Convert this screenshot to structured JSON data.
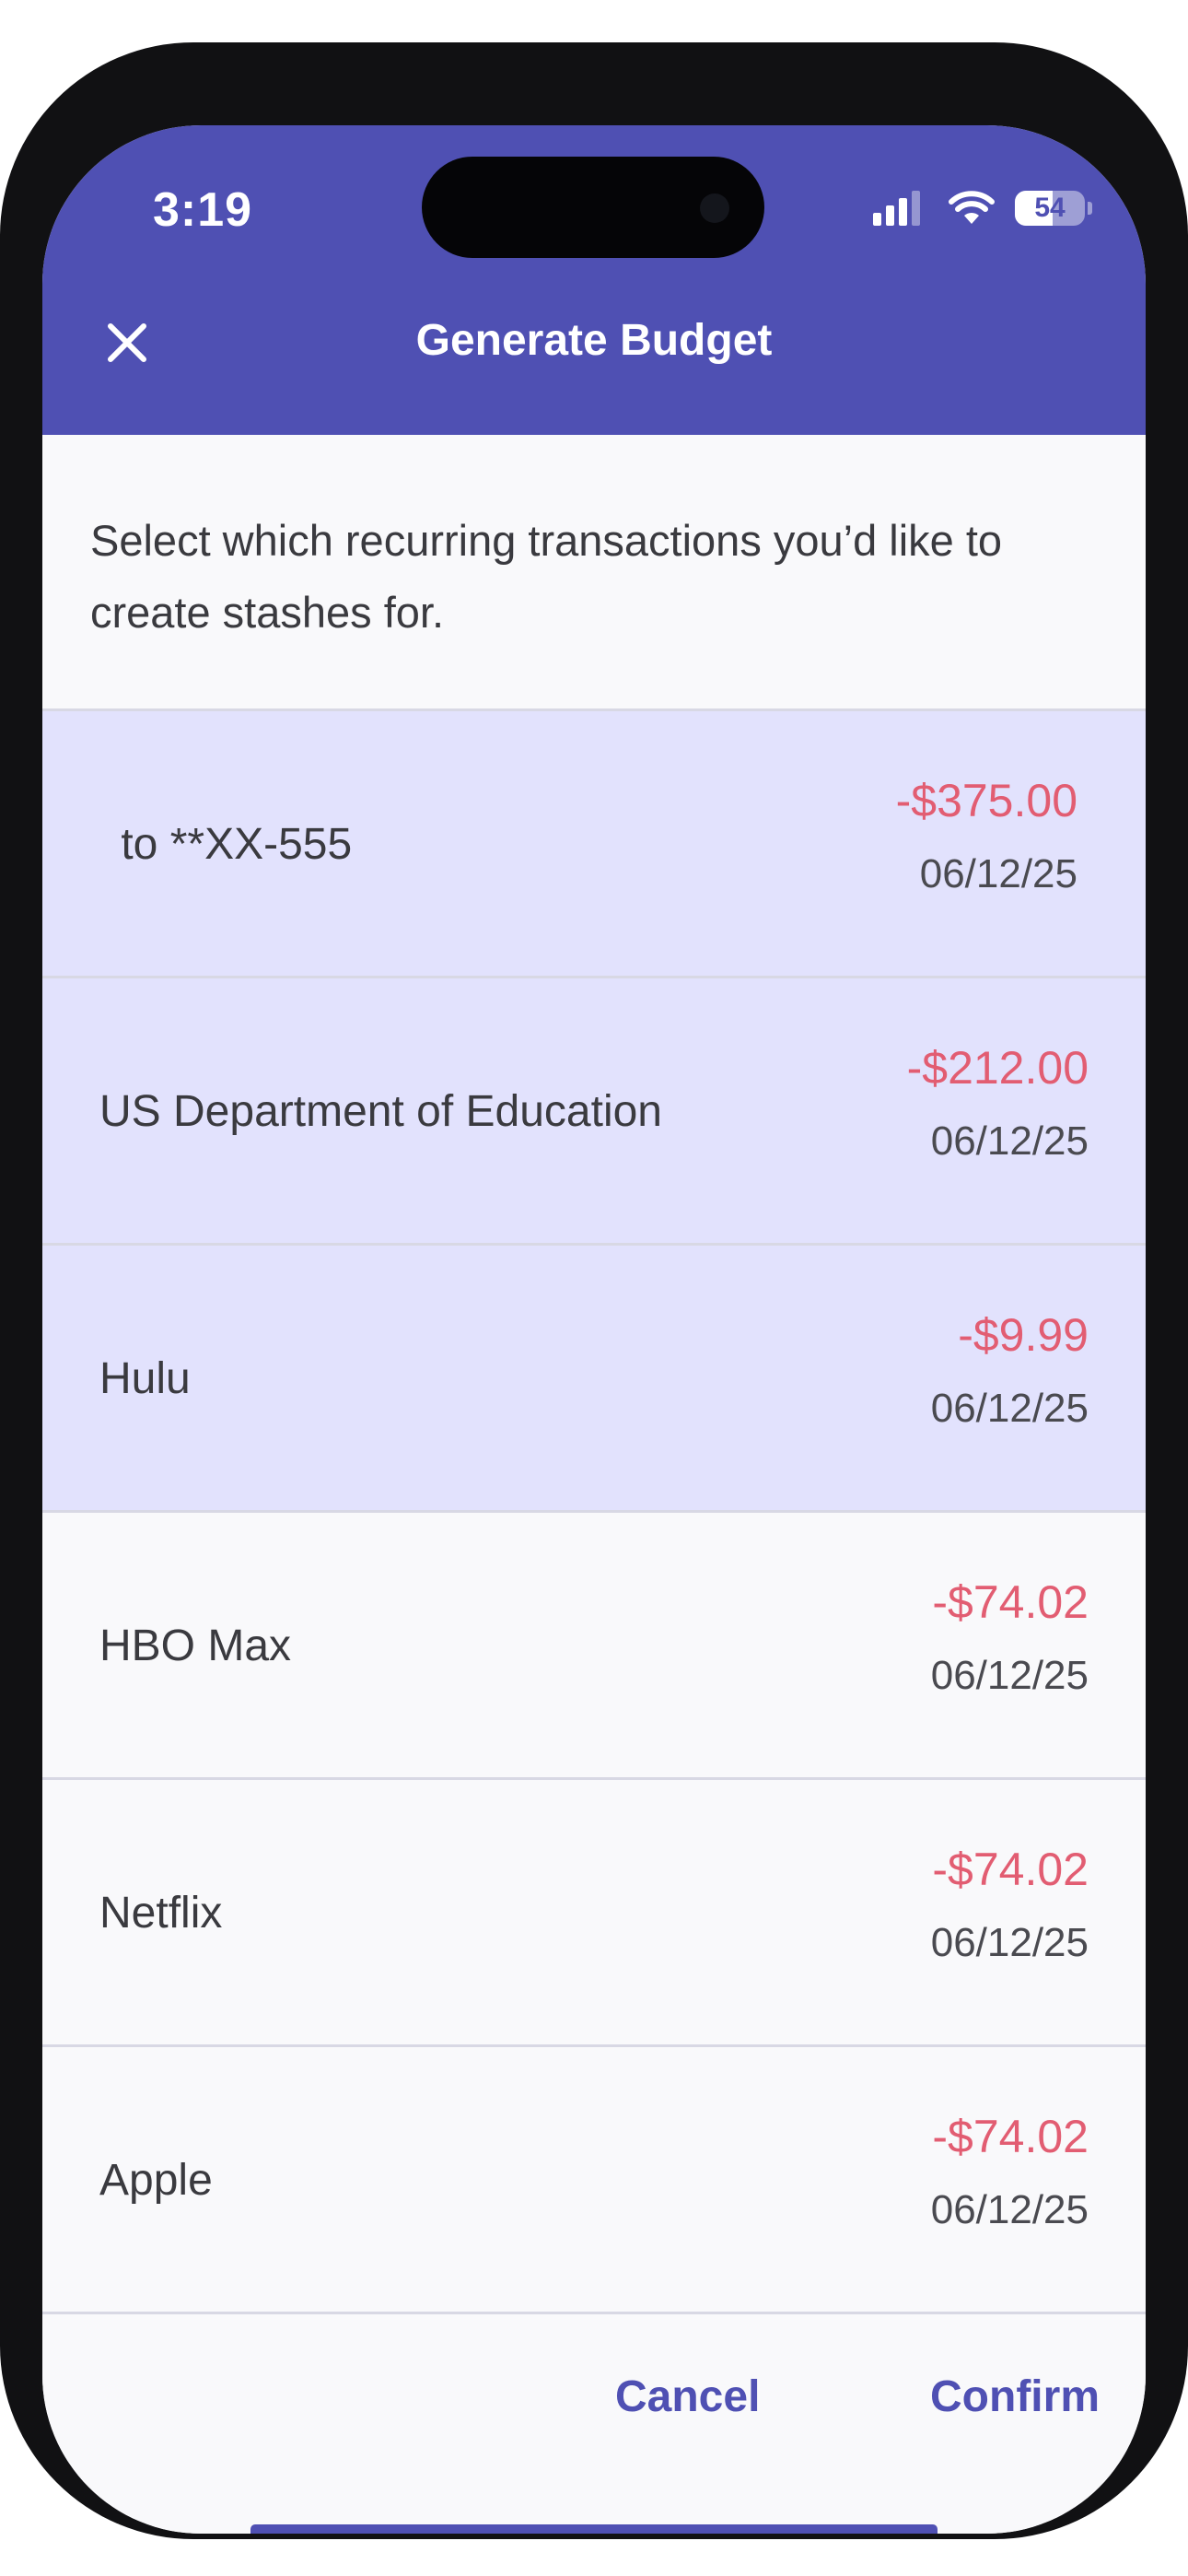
{
  "status_bar": {
    "time": "3:19",
    "battery_percent": "54",
    "icons": [
      "cellular-signal-icon",
      "wifi-icon",
      "battery-icon"
    ]
  },
  "header": {
    "title": "Generate Budget",
    "close_icon": "close-icon"
  },
  "intro": {
    "text": "Select which recurring transactions you’d like to create stashes for."
  },
  "transactions": [
    {
      "name": " to **XX-555",
      "amount": "-$375.00",
      "date": "06/12/25",
      "selected": true
    },
    {
      "name": "US Department of Education",
      "amount": "-$212.00",
      "date": "06/12/25",
      "selected": true
    },
    {
      "name": "Hulu",
      "amount": "-$9.99",
      "date": "06/12/25",
      "selected": true
    },
    {
      "name": "HBO Max",
      "amount": "-$74.02",
      "date": "06/12/25",
      "selected": false
    },
    {
      "name": "Netflix",
      "amount": "-$74.02",
      "date": "06/12/25",
      "selected": false
    },
    {
      "name": "Apple",
      "amount": "-$74.02",
      "date": "06/12/25",
      "selected": false
    }
  ],
  "footer": {
    "cancel_label": "Cancel",
    "confirm_label": "Confirm"
  },
  "colors": {
    "accent": "#4f50b3",
    "selected_row": "#e2e2fd",
    "amount_negative": "#e25d72",
    "background": "#f9f9fb"
  }
}
